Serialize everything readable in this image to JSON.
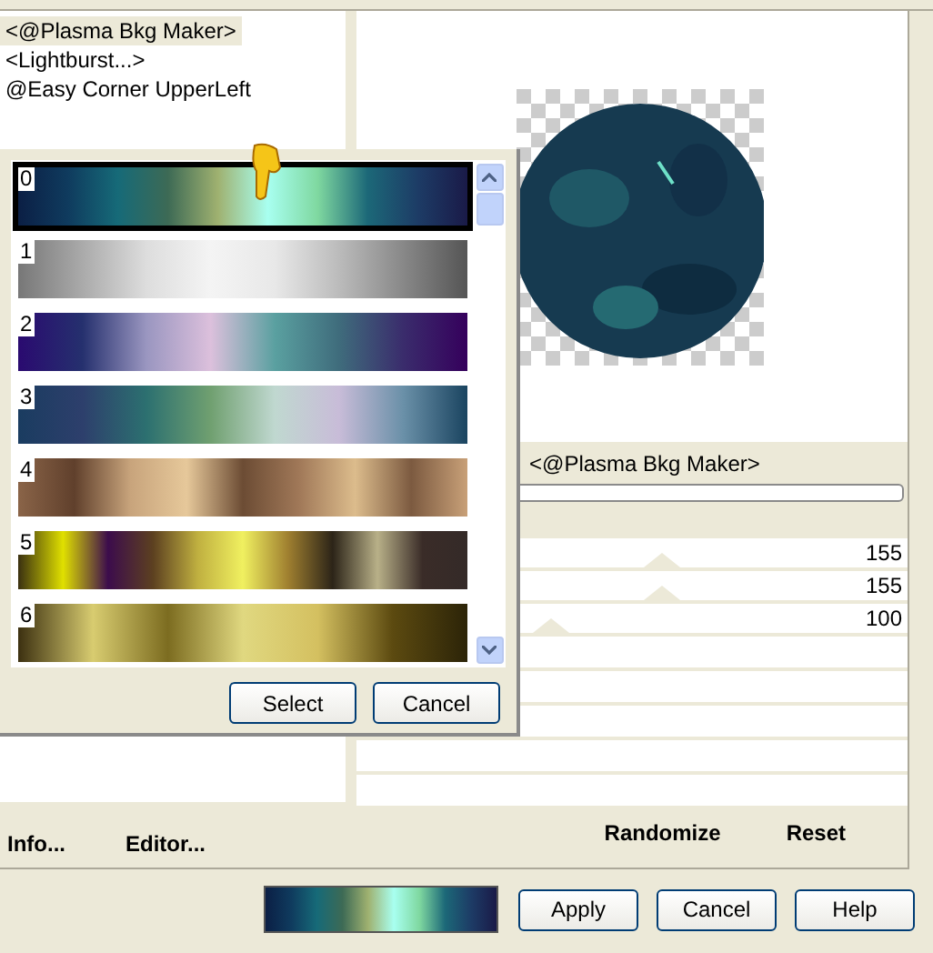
{
  "filters": [
    {
      "label": "<@Plasma Bkg Maker>",
      "selected": true
    },
    {
      "label": "<Lightburst...>",
      "selected": false
    },
    {
      "label": "@Easy Corner UpperLeft",
      "selected": false
    }
  ],
  "left_buttons": [
    "Info...",
    "Editor..."
  ],
  "preview": {
    "kind": "picture"
  },
  "filter_name": "<@Plasma Bkg Maker>",
  "sliders": [
    {
      "level": 0.61,
      "reading": "155"
    },
    {
      "level": 0.61,
      "reading": "155"
    },
    {
      "level": 0.39,
      "reading": "100"
    }
  ],
  "right_buttons": [
    "Randomize",
    "Reset"
  ],
  "gradient_picker": {
    "gradients": [
      {
        "label": "0",
        "selected": true
      },
      {
        "label": "1",
        "selected": false
      },
      {
        "label": "2",
        "selected": false
      },
      {
        "label": "3",
        "selected": false
      },
      {
        "label": "4",
        "selected": false
      },
      {
        "label": "5",
        "selected": false
      },
      {
        "label": "6",
        "selected": false
      }
    ]
  },
  "picker_buttons": [
    "Select",
    "Cancel"
  ],
  "dialog_buttons": [
    "Apply",
    "Cancel",
    "Help"
  ]
}
